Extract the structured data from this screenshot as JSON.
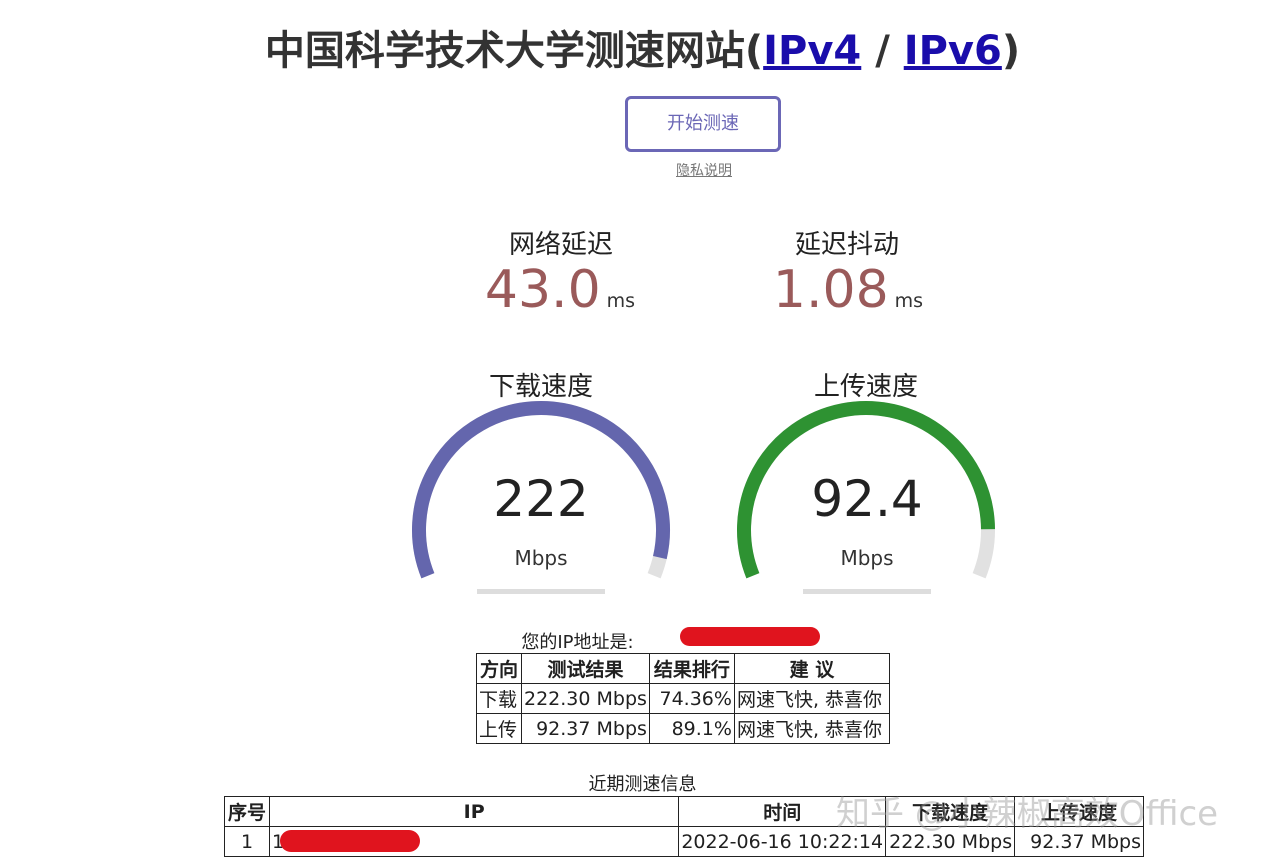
{
  "header": {
    "title_text": "中国科学技术大学测速网站(",
    "ipv4_label": "IPv4",
    "separator": " / ",
    "ipv6_label": "IPv6",
    "title_close": ")"
  },
  "controls": {
    "start_label": "开始测速",
    "privacy_label": "隐私说明"
  },
  "metrics": {
    "latency": {
      "label": "网络延迟",
      "value": "43.0",
      "unit": "ms"
    },
    "jitter": {
      "label": "延迟抖动",
      "value": "1.08",
      "unit": "ms"
    }
  },
  "gauges": {
    "download": {
      "label": "下载速度",
      "value": "222",
      "unit": "Mbps",
      "fill": 0.96,
      "color": "#6466ad"
    },
    "upload": {
      "label": "上传速度",
      "value": "92.4",
      "unit": "Mbps",
      "fill": 0.9,
      "color": "#2e9232"
    }
  },
  "result": {
    "ip_prefix": "您的IP地址是:",
    "headers": [
      "方向",
      "测试结果",
      "结果排行",
      "建 议"
    ],
    "rows": [
      [
        "下载",
        "222.30 Mbps",
        "74.36%",
        "网速飞快, 恭喜你"
      ],
      [
        "上传",
        "92.37 Mbps",
        "89.1%",
        "网速飞快, 恭喜你"
      ]
    ]
  },
  "recent": {
    "title": "近期测速信息",
    "headers": [
      "序号",
      "IP",
      "时间",
      "下载速度",
      "上传速度"
    ],
    "rows": [
      [
        "1",
        "1",
        "2022-06-16 10:22:14",
        "222.30 Mbps",
        "92.37 Mbps"
      ]
    ]
  },
  "watermark": "知乎 @小辣椒高效Office"
}
